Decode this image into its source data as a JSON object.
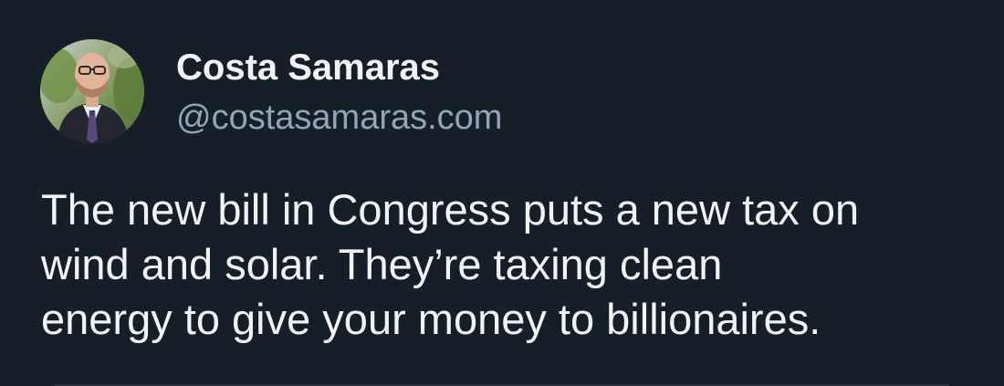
{
  "post": {
    "author": {
      "display_name": "Costa Samaras",
      "handle": "@costasamaras.com"
    },
    "text_lines": [
      "The new bill in Congress puts a new tax on",
      "wind and solar. They’re taxing clean",
      "energy to give your money to billionaires."
    ]
  },
  "colors": {
    "background": "#161e27",
    "text": "#f1f3f5",
    "handle": "#93a4b7"
  }
}
